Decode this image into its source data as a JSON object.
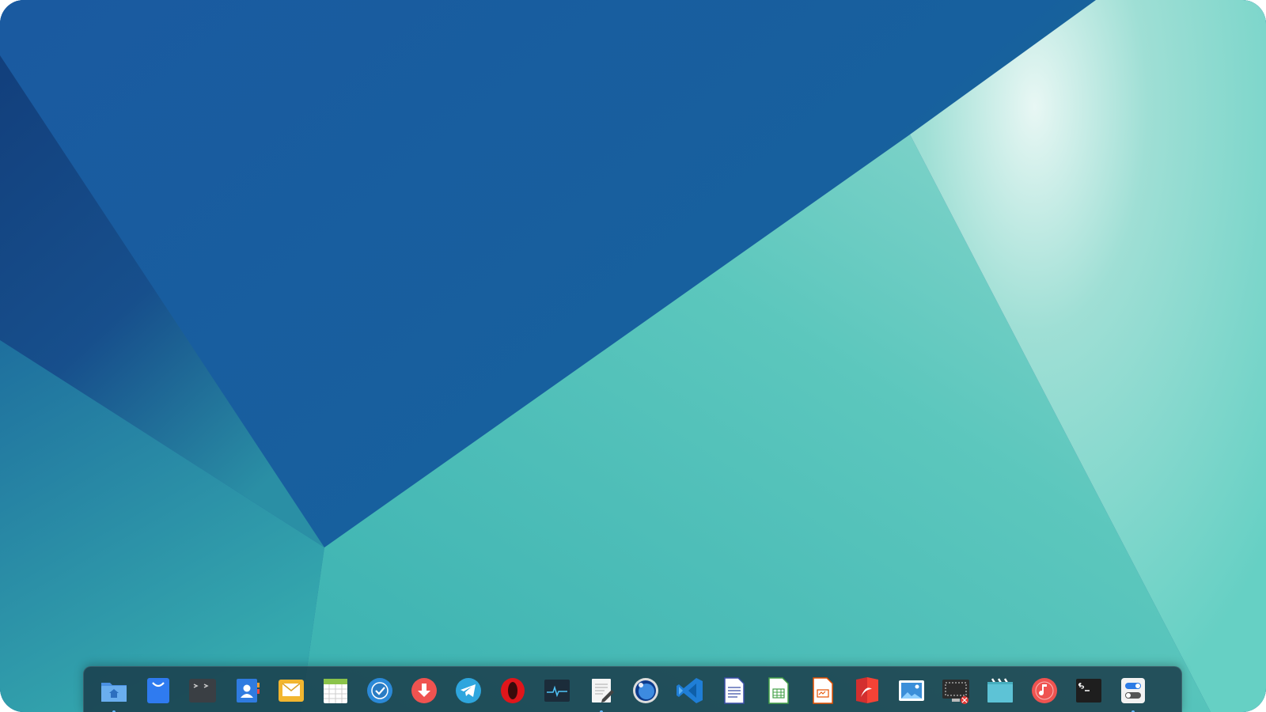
{
  "desktop": {
    "wallpaper_colors": {
      "deep_blue": "#1b5a9c",
      "dark_blue": "#163f80",
      "teal": "#45b8b5",
      "light_teal": "#a8e2da",
      "glow": "#e6f6f3"
    }
  },
  "dock": {
    "background": "#1d3a48",
    "apps": [
      {
        "icon": "file-manager-icon",
        "running": true
      },
      {
        "icon": "app-store-icon",
        "running": false
      },
      {
        "icon": "terminal-theme-icon",
        "running": false
      },
      {
        "icon": "contacts-icon",
        "running": false
      },
      {
        "icon": "mail-icon",
        "running": false
      },
      {
        "icon": "calendar-icon",
        "running": false
      },
      {
        "icon": "tasks-check-icon",
        "running": false
      },
      {
        "icon": "downloader-icon",
        "running": false
      },
      {
        "icon": "telegram-icon",
        "running": false
      },
      {
        "icon": "opera-browser-icon",
        "running": false
      },
      {
        "icon": "system-monitor-icon",
        "running": false
      },
      {
        "icon": "text-editor-icon",
        "running": true
      },
      {
        "icon": "camera-lens-icon",
        "running": false
      },
      {
        "icon": "vscode-icon",
        "running": false
      },
      {
        "icon": "libreoffice-writer-icon",
        "running": false
      },
      {
        "icon": "libreoffice-calc-icon",
        "running": false
      },
      {
        "icon": "libreoffice-impress-icon",
        "running": false
      },
      {
        "icon": "pdf-reader-icon",
        "running": false
      },
      {
        "icon": "image-viewer-icon",
        "running": false
      },
      {
        "icon": "screen-recorder-icon",
        "running": false
      },
      {
        "icon": "video-player-icon",
        "running": false
      },
      {
        "icon": "music-player-icon",
        "running": false
      },
      {
        "icon": "terminal-icon",
        "running": false
      },
      {
        "icon": "settings-toggle-icon",
        "running": true
      }
    ]
  }
}
